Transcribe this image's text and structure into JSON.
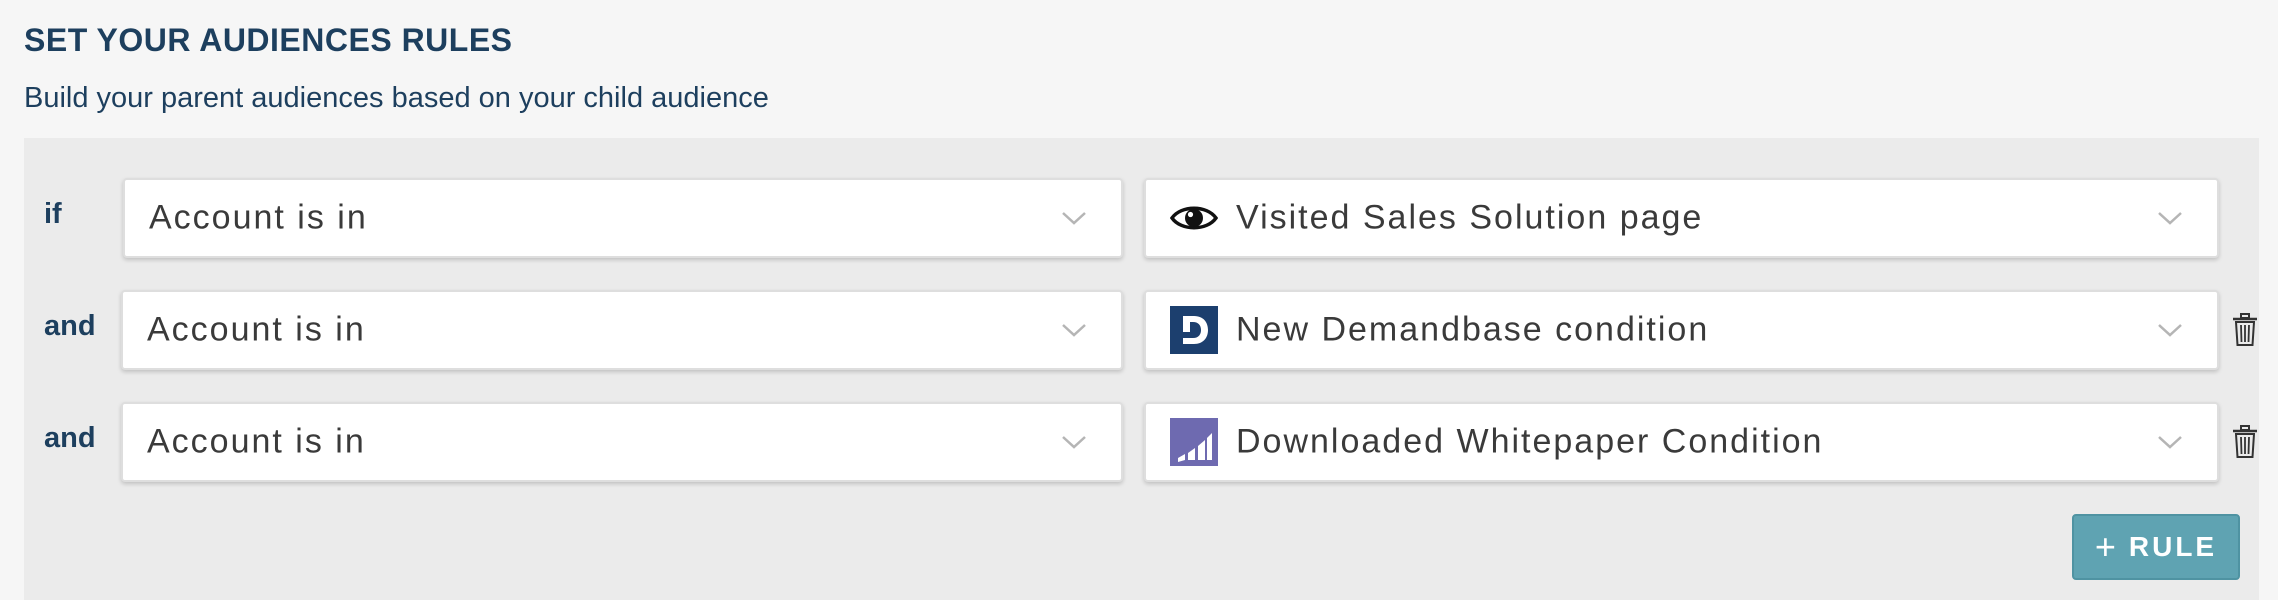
{
  "header": {
    "title": "SET YOUR AUDIENCES RULES",
    "subtitle": "Build your parent audiences based on your child audience"
  },
  "rules": [
    {
      "operator": "if",
      "relation": "Account is in",
      "condition": "Visited Sales Solution page",
      "condition_icon": "eye-icon",
      "deletable": false
    },
    {
      "operator": "and",
      "relation": "Account is in",
      "condition": "New Demandbase condition",
      "condition_icon": "demandbase-logo-icon",
      "deletable": true
    },
    {
      "operator": "and",
      "relation": "Account is in",
      "condition": "Downloaded Whitepaper Condition",
      "condition_icon": "marketo-logo-icon",
      "deletable": true
    }
  ],
  "actions": {
    "add_rule_label": "RULE",
    "add_rule_icon": "plus-icon"
  },
  "colors": {
    "heading": "#1d3f5e",
    "panel_bg": "#ebebeb",
    "button_bg": "#5fa3b2",
    "demandbase_blue": "#1c3f6e",
    "marketo_purple": "#6e6ab0"
  }
}
